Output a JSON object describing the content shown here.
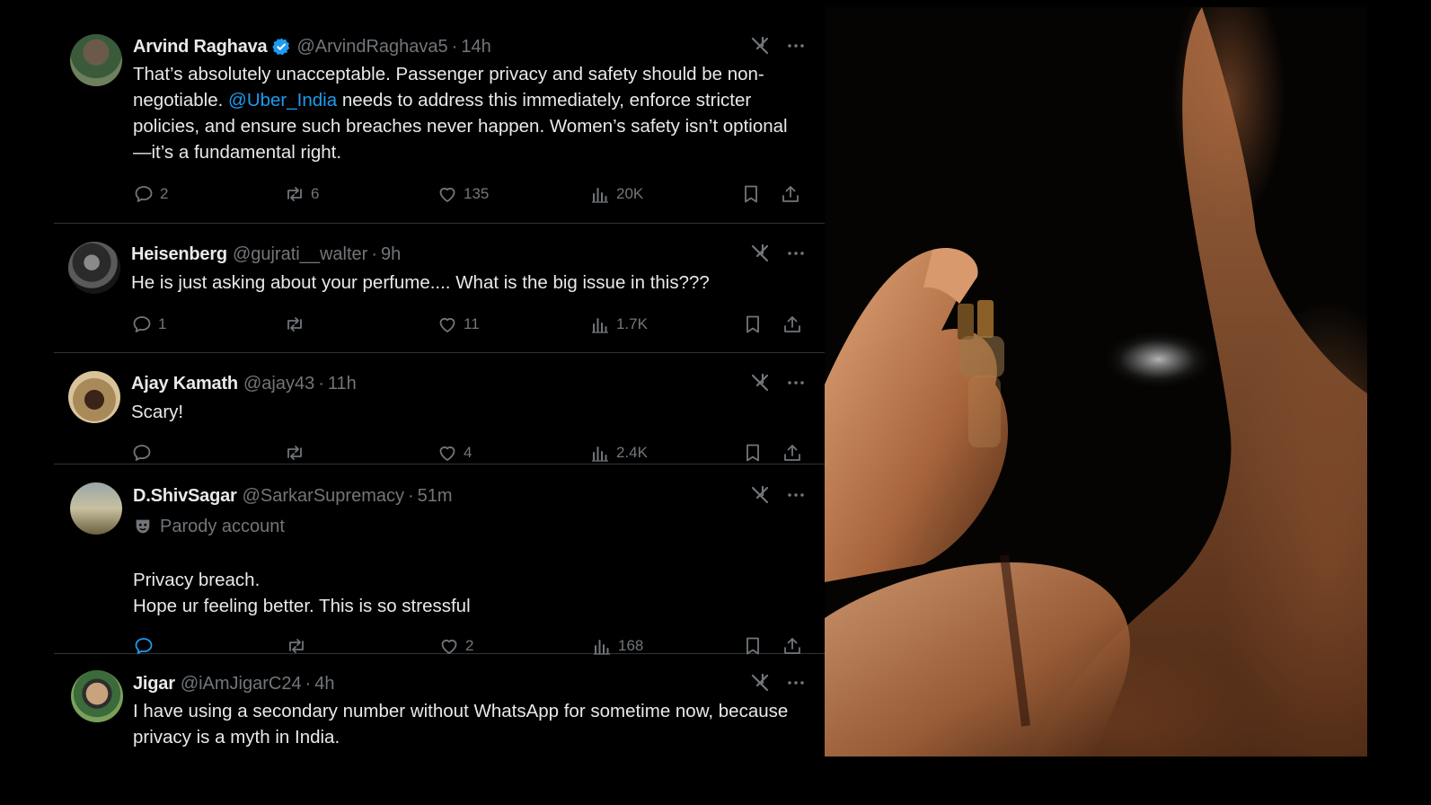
{
  "colors": {
    "background": "#000000",
    "text": "#e7e9ea",
    "muted": "#71767b",
    "accent": "#1d9bf0",
    "divider": "#2f3336"
  },
  "tweets": [
    {
      "name": "Arvind Raghava",
      "verified": true,
      "handle": "@ArvindRaghava5",
      "time": "14h",
      "text_before": "That’s absolutely unacceptable. Passenger privacy and safety should be non-negotiable.",
      "mention": "@Uber_India",
      "text_after": "needs to address this immediately, enforce stricter policies, and ensure such breaches never happen. Women’s safety isn’t optional—it’s a fundamental right.",
      "replies": "2",
      "reposts": "6",
      "likes": "135",
      "views": "20K"
    },
    {
      "name": "Heisenberg",
      "handle": "@gujrati__walter",
      "time": "9h",
      "text": "He is just asking about your perfume.... What is the big issue in this???",
      "replies": "1",
      "reposts": "",
      "likes": "11",
      "views": "1.7K"
    },
    {
      "name": "Ajay Kamath",
      "handle": "@ajay43",
      "time": "11h",
      "text": "Scary!",
      "replies": "",
      "reposts": "",
      "likes": "4",
      "views": "2.4K"
    },
    {
      "name": "D.ShivSagar",
      "handle": "@SarkarSupremacy",
      "time": "51m",
      "parody_label": "Parody account",
      "line1": "Privacy breach.",
      "line2": "Hope ur feeling better. This is so stressful",
      "replies": "",
      "reposts": "",
      "likes": "2",
      "views": "168"
    },
    {
      "name": "Jigar",
      "handle": "@iAmJigarC24",
      "time": "4h",
      "text": "I have using a secondary number without WhatsApp for sometime now, because privacy is a myth in India."
    }
  ],
  "ui": {
    "dot": "·"
  },
  "icons": [
    "reply-icon",
    "repost-icon",
    "like-icon",
    "views-icon",
    "bookmark-icon",
    "share-icon",
    "grok-icon",
    "more-icon",
    "verified-badge-icon",
    "parody-mask-icon"
  ]
}
